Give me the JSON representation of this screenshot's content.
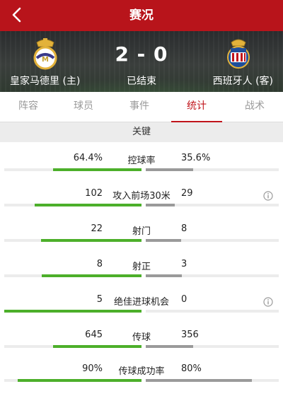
{
  "header": {
    "title": "赛况",
    "back_icon": "chevron-left-icon"
  },
  "match": {
    "home_team": "皇家马德里 (主)",
    "away_team": "西班牙人 (客)",
    "score": "2 - 0",
    "status": "已结束",
    "home_logo": "real-madrid-crest-icon",
    "away_logo": "espanyol-crest-icon"
  },
  "tabs": [
    {
      "label": "阵容"
    },
    {
      "label": "球员"
    },
    {
      "label": "事件"
    },
    {
      "label": "统计",
      "active": true
    },
    {
      "label": "战术"
    }
  ],
  "section": {
    "title": "关键"
  },
  "colors": {
    "brand": "#b8141b",
    "active_tab": "#c0141b",
    "home_bar": "#4caf2a",
    "away_bar": "#9a9a9a"
  },
  "stats": [
    {
      "label": "控球率",
      "home": "64.4%",
      "away": "35.6%",
      "home_fraction": 0.644,
      "away_fraction": 0.356,
      "info": false
    },
    {
      "label": "攻入前场30米",
      "home": "102",
      "away": "29",
      "home_fraction": 0.78,
      "away_fraction": 0.22,
      "info": true
    },
    {
      "label": "射门",
      "home": "22",
      "away": "8",
      "home_fraction": 0.733,
      "away_fraction": 0.267,
      "info": false
    },
    {
      "label": "射正",
      "home": "8",
      "away": "3",
      "home_fraction": 0.727,
      "away_fraction": 0.273,
      "info": false
    },
    {
      "label": "绝佳进球机会",
      "home": "5",
      "away": "0",
      "home_fraction": 1.0,
      "away_fraction": 0.0,
      "info": true
    },
    {
      "label": "传球",
      "home": "645",
      "away": "356",
      "home_fraction": 0.644,
      "away_fraction": 0.356,
      "info": false
    },
    {
      "label": "传球成功率",
      "home": "90%",
      "away": "80%",
      "home_fraction": 0.9,
      "away_fraction": 0.8,
      "info": false
    }
  ]
}
